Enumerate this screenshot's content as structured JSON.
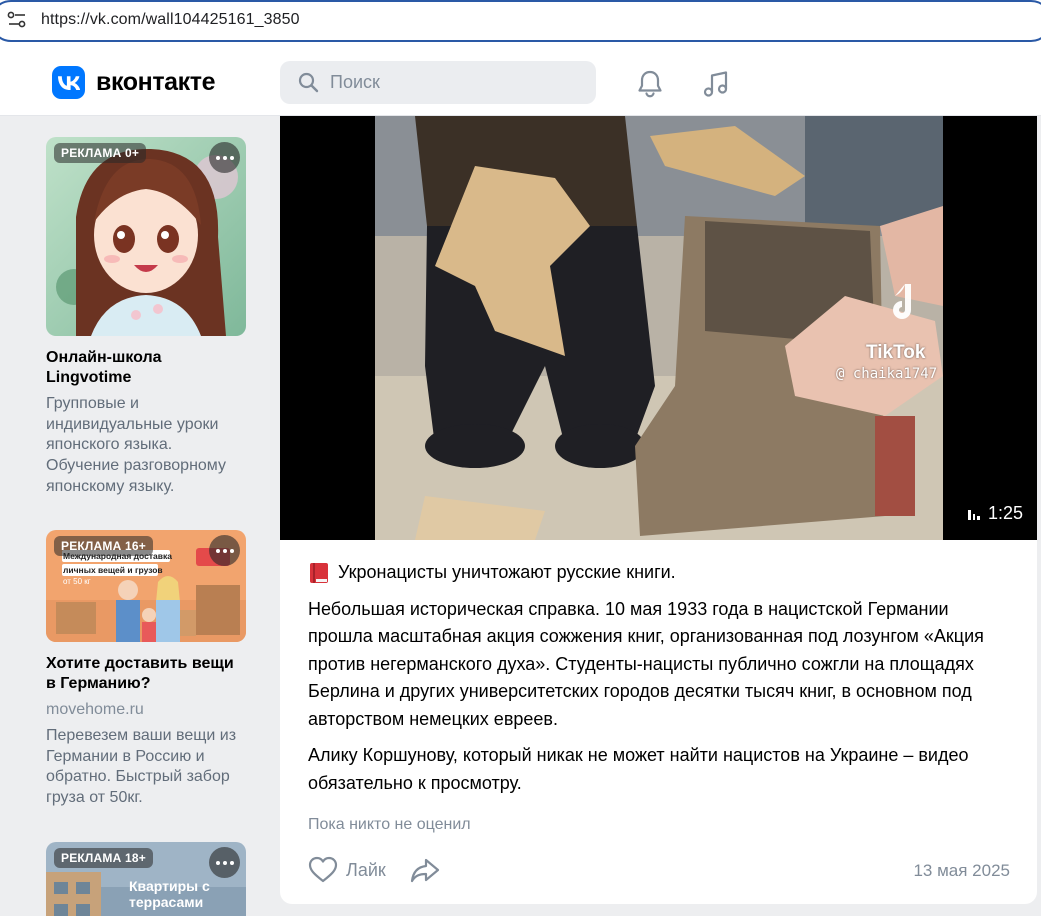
{
  "browser": {
    "url": "https://vk.com/wall104425161_3850"
  },
  "header": {
    "logo_text": "вконтакте",
    "search_placeholder": "Поиск"
  },
  "ads": [
    {
      "badge": "РЕКЛАМА 0+",
      "title": "Онлайн-школа Lingvotime",
      "description": "Групповые и индивидуальные уроки японского языка. Обучение разговорному японскому языку."
    },
    {
      "badge": "РЕКЛАМА 16+",
      "image_line1": "Международная доставка",
      "image_line2": "личных вещей и грузов",
      "image_line3": "от 50 кг",
      "title": "Хотите доставить вещи в Германию?",
      "domain": "movehome.ru",
      "description": "Перевезем ваши вещи из Германии в Россию и обратно. Быстрый забор груза от 50кг."
    },
    {
      "badge": "РЕКЛАМА 18+",
      "image_text": "Квартиры с террасами"
    }
  ],
  "post": {
    "video": {
      "watermark": "TikTok",
      "watermark_user": "@ chaika1747",
      "duration": "1:25"
    },
    "headline": "Укронацисты уничтожают русские книги.",
    "paragraph1": "Небольшая историческая справка. 10 мая 1933 года в нацистской Германии прошла масштабная акция сожжения книг, организованная под лозунгом «Акция против негерманского духа». Студенты-нацисты публично сожгли на площадях Берлина и других университетских городов десятки тысяч книг, в основном под авторством немецких евреев.",
    "paragraph2": "Алику Коршунову, который никак не может найти нацистов на Украине – видео обязательно к просмотру.",
    "likes_note": "Пока никто не оценил",
    "like_label": "Лайк",
    "date": "13 мая 2025"
  }
}
